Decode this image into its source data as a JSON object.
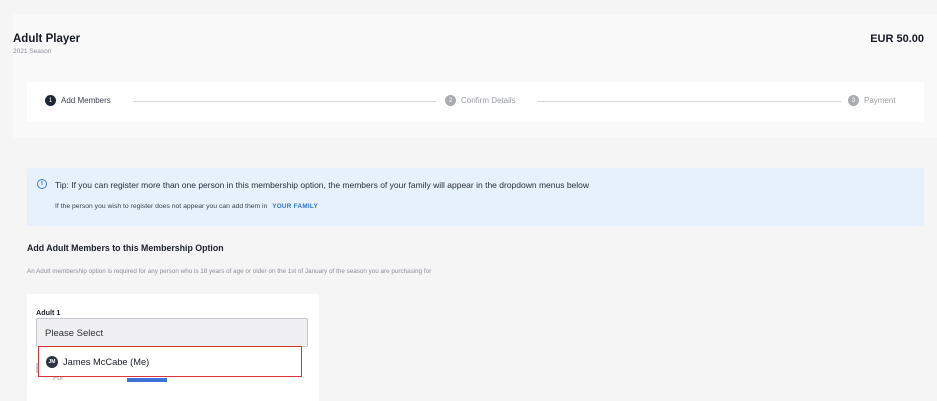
{
  "plan": {
    "title": "Adult Player",
    "season": "2021 Season",
    "price": "EUR 50.00"
  },
  "stepper": {
    "steps": [
      {
        "number": "1",
        "label": "Add Members",
        "active": true
      },
      {
        "number": "2",
        "label": "Confirm Details",
        "active": false
      },
      {
        "number": "3",
        "label": "Payment",
        "active": false
      }
    ]
  },
  "tip": {
    "icon": "info-icon",
    "icon_glyph": "i",
    "text": "Tip: If you can register more than one person in this membership option, the members of your family will appear in the dropdown menus below",
    "subtext": "If the person you wish to register does not appear you can add them in",
    "link_label": "YOUR FAMILY"
  },
  "section": {
    "title": "Add Adult Members to this Membership Option",
    "description": "An Adult membership option is required for any person who is 18 years of age or older on the 1st of January of the season you are purchasing for"
  },
  "member": {
    "label": "Adult 1",
    "select_placeholder": "Please Select",
    "options": [
      {
        "avatar_initials": "JM",
        "label": "James McCabe (Me)"
      }
    ],
    "partial_label": "For"
  },
  "colors": {
    "accent": "#3d73d8",
    "highlight_border": "#d9343a",
    "tip_background": "#e7f1fb",
    "active_step": "#1e2736"
  }
}
